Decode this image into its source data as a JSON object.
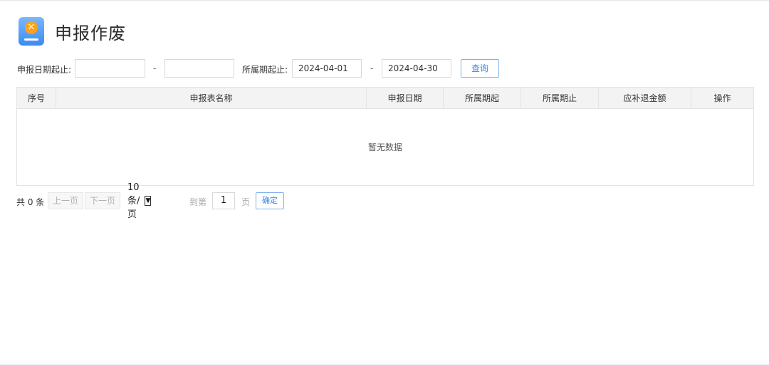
{
  "header": {
    "title": "申报作废"
  },
  "filters": {
    "declare_date_label": "申报日期起止:",
    "declare_start": "",
    "declare_end": "",
    "separator": "-",
    "period_label": "所属期起止:",
    "period_start": "2024-04-01",
    "period_end": "2024-04-30",
    "query_button": "查询"
  },
  "table": {
    "columns": [
      "序号",
      "申报表名称",
      "申报日期",
      "所属期起",
      "所属期止",
      "应补退金额",
      "操作"
    ],
    "rows": [],
    "empty_text": "暂无数据"
  },
  "pagination": {
    "total_text": "共 0 条",
    "prev_label": "上一页",
    "next_label": "下一页",
    "page_size": "10 条/页",
    "goto_label": "到第",
    "page_value": "1",
    "page_unit": "页",
    "confirm_label": "确定"
  },
  "colors": {
    "accent": "#3b86e0",
    "icon_bg": "#3d8bf0",
    "icon_badge": "#ffa11a"
  }
}
